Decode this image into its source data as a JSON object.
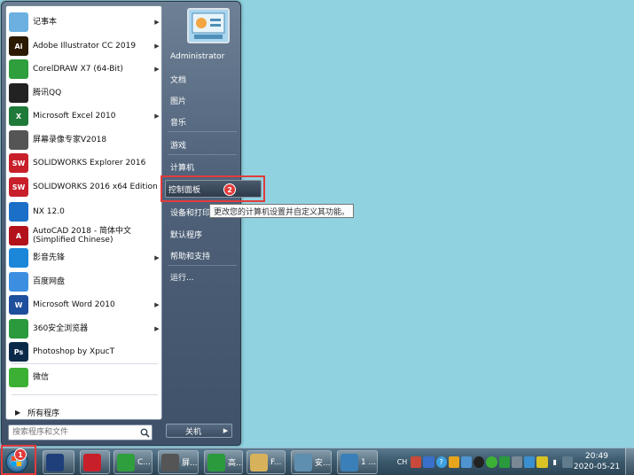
{
  "programs": [
    {
      "label": "记事本",
      "icon": "notepad-icon",
      "color": "#6bb0e0",
      "arrow": "▶"
    },
    {
      "label": "Adobe Illustrator CC 2019",
      "icon": "illustrator-icon",
      "color": "#2b1a00",
      "glyph": "Ai",
      "arrow": "▶"
    },
    {
      "label": "CorelDRAW X7 (64-Bit)",
      "icon": "coreldraw-icon",
      "color": "#2f9e3c",
      "arrow": "▶"
    },
    {
      "label": "腾讯QQ",
      "icon": "qq-icon",
      "color": "#222222",
      "arrow": ""
    },
    {
      "label": "Microsoft Excel 2010",
      "icon": "excel-icon",
      "color": "#1f7a3a",
      "glyph": "X",
      "arrow": "▶"
    },
    {
      "label": "屏幕录像专家V2018",
      "icon": "screen-recorder-icon",
      "color": "#555555",
      "arrow": ""
    },
    {
      "label": "SOLIDWORKS Explorer 2016",
      "icon": "solidworks-explorer-icon",
      "color": "#c8202a",
      "glyph": "SW",
      "arrow": ""
    },
    {
      "label": "SOLIDWORKS 2016 x64 Edition",
      "icon": "solidworks-icon",
      "color": "#c8202a",
      "glyph": "SW",
      "arrow": ""
    },
    {
      "label": "NX 12.0",
      "icon": "nx-icon",
      "color": "#1b6fc7",
      "arrow": ""
    },
    {
      "label": "AutoCAD 2018 - 简体中文 (Simplified Chinese)",
      "icon": "autocad-icon",
      "color": "#b3121b",
      "glyph": "A",
      "arrow": ""
    },
    {
      "label": "影音先锋",
      "icon": "media-player-icon",
      "color": "#1c86d8",
      "arrow": "▶"
    },
    {
      "label": "百度网盘",
      "icon": "baidu-netdisk-icon",
      "color": "#3c8fe0",
      "arrow": ""
    },
    {
      "label": "Microsoft Word 2010",
      "icon": "word-icon",
      "color": "#1e4f9c",
      "glyph": "W",
      "arrow": "▶"
    },
    {
      "label": "360安全浏览器",
      "icon": "browser-360-icon",
      "color": "#2a9a3c",
      "arrow": "▶"
    },
    {
      "label": "Photoshop by XpucT",
      "icon": "photoshop-icon",
      "color": "#0b2a4a",
      "glyph": "Ps",
      "arrow": ""
    },
    {
      "label": "微信",
      "icon": "wechat-icon",
      "color": "#3cb034",
      "arrow": ""
    }
  ],
  "all_programs": "所有程序",
  "search": {
    "placeholder": "搜索程序和文件"
  },
  "right_pane": {
    "user": "Administrator",
    "items": [
      "文档",
      "图片",
      "音乐",
      "游戏",
      "计算机",
      "控制面板",
      "设备和打印机",
      "默认程序",
      "帮助和支持",
      "运行..."
    ],
    "tooltip": "更改您的计算机设置并自定义其功能。",
    "shutdown": "关机"
  },
  "badges": {
    "one": "1",
    "two": "2"
  },
  "taskbar": {
    "buttons": [
      {
        "label": "",
        "icon": "paint-brush-icon"
      },
      {
        "label": "",
        "icon": "solidworks-taskbar-icon"
      },
      {
        "label": "C...",
        "icon": "coreldraw-taskbar-icon"
      },
      {
        "label": "屏...",
        "icon": "screen-recorder-taskbar-icon"
      },
      {
        "label": "高...",
        "icon": "browser-360-taskbar-icon"
      },
      {
        "label": "F...",
        "icon": "folder-icon"
      },
      {
        "label": "安...",
        "icon": "install-icon"
      },
      {
        "label": "1 ...",
        "icon": "image-viewer-icon"
      }
    ],
    "tray_ime": "CH",
    "clock_time": "20:49",
    "clock_date": "2020-05-21"
  }
}
